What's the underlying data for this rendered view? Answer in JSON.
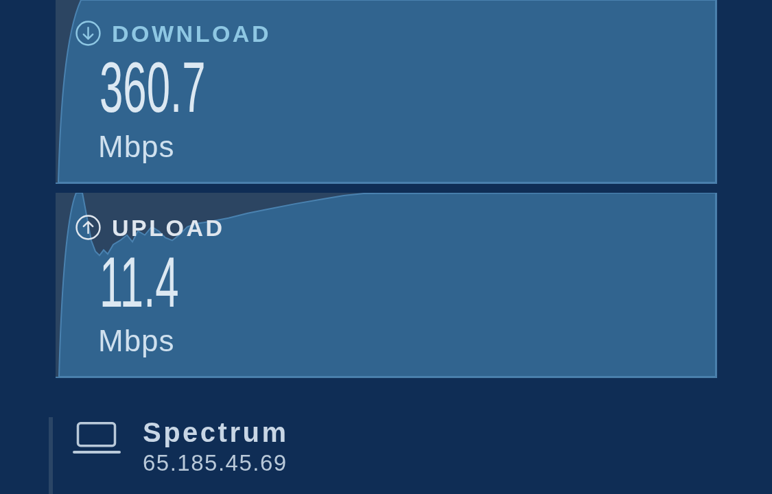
{
  "speed_panels": [
    {
      "kind": "download",
      "label": "DOWNLOAD",
      "value": "360.7",
      "unit": "Mbps"
    },
    {
      "kind": "upload",
      "label": "UPLOAD",
      "value": "11.4",
      "unit": "Mbps"
    }
  ],
  "connection": {
    "provider": "Spectrum",
    "ip_address": "65.185.45.69"
  }
}
